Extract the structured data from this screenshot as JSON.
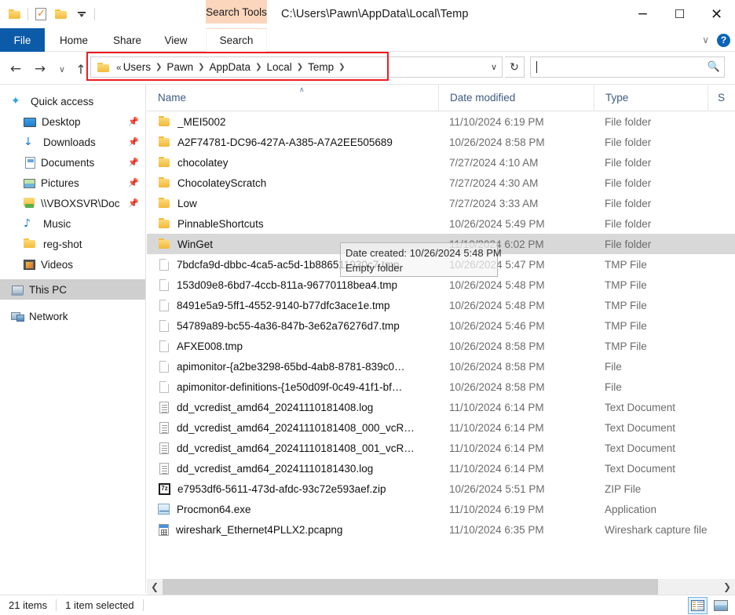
{
  "window": {
    "title": "C:\\Users\\Pawn\\AppData\\Local\\Temp",
    "contextual_tab": "Search Tools",
    "minimize": "−",
    "maximize": "☐",
    "close": "✕",
    "ribbon_expand": "∨",
    "help": "?"
  },
  "quick_access_toolbar": {
    "folder": "folder-icon",
    "properties": "properties-icon",
    "new_folder": "new-folder-icon",
    "customize": "customize-icon"
  },
  "ribbon": {
    "tabs": [
      {
        "label": "File"
      },
      {
        "label": "Home"
      },
      {
        "label": "Share"
      },
      {
        "label": "View"
      },
      {
        "label": "Search"
      }
    ]
  },
  "navigation": {
    "back": "←",
    "forward": "→",
    "recent": "∨",
    "up": "↑",
    "refresh": "↻",
    "dropdown": "∨",
    "overflow": "«",
    "separator": "❯",
    "breadcrumbs": [
      "Users",
      "Pawn",
      "AppData",
      "Local",
      "Temp"
    ],
    "highlight_color": "#ee1c22"
  },
  "search": {
    "value": "",
    "placeholder": "",
    "icon": "search-icon"
  },
  "sidebar": {
    "items": [
      {
        "label": "Quick access",
        "icon": "star-icon",
        "pinned": false,
        "selected": false,
        "indent": 0
      },
      {
        "label": "Desktop",
        "icon": "desktop-icon",
        "pinned": true,
        "selected": false,
        "indent": 1
      },
      {
        "label": "Downloads",
        "icon": "download-icon",
        "pinned": true,
        "selected": false,
        "indent": 1
      },
      {
        "label": "Documents",
        "icon": "documents-icon",
        "pinned": true,
        "selected": false,
        "indent": 1
      },
      {
        "label": "Pictures",
        "icon": "pictures-icon",
        "pinned": true,
        "selected": false,
        "indent": 1
      },
      {
        "label": "\\\\VBOXSVR\\Doc",
        "icon": "network-folder-icon",
        "pinned": true,
        "selected": false,
        "indent": 1
      },
      {
        "label": "Music",
        "icon": "music-icon",
        "pinned": false,
        "selected": false,
        "indent": 1
      },
      {
        "label": "reg-shot",
        "icon": "folder-icon",
        "pinned": false,
        "selected": false,
        "indent": 1
      },
      {
        "label": "Videos",
        "icon": "videos-icon",
        "pinned": false,
        "selected": false,
        "indent": 1
      },
      {
        "label": "This PC",
        "icon": "computer-icon",
        "pinned": false,
        "selected": true,
        "indent": 0
      },
      {
        "label": "Network",
        "icon": "network-icon",
        "pinned": false,
        "selected": false,
        "indent": 0
      }
    ]
  },
  "file_list": {
    "columns": [
      {
        "label": "Name",
        "sorted": true,
        "sort_caret": "∧"
      },
      {
        "label": "Date modified",
        "sorted": false
      },
      {
        "label": "Type",
        "sorted": false
      },
      {
        "label": "S",
        "sorted": false
      }
    ],
    "rows": [
      {
        "name": "_MEI5002",
        "date": "11/10/2024 6:19 PM",
        "type": "File folder",
        "icon": "folder-icon",
        "selected": false
      },
      {
        "name": "A2F74781-DC96-427A-A385-A7A2EE505689",
        "date": "10/26/2024 8:58 PM",
        "type": "File folder",
        "icon": "folder-icon",
        "selected": false
      },
      {
        "name": "chocolatey",
        "date": "7/27/2024 4:10 AM",
        "type": "File folder",
        "icon": "folder-icon",
        "selected": false
      },
      {
        "name": "ChocolateyScratch",
        "date": "7/27/2024 4:30 AM",
        "type": "File folder",
        "icon": "folder-icon",
        "selected": false
      },
      {
        "name": "Low",
        "date": "7/27/2024 3:33 AM",
        "type": "File folder",
        "icon": "folder-icon",
        "selected": false
      },
      {
        "name": "PinnableShortcuts",
        "date": "10/26/2024 5:49 PM",
        "type": "File folder",
        "icon": "folder-icon",
        "selected": false
      },
      {
        "name": "WinGet",
        "date": "11/10/2024 6:02 PM",
        "type": "File folder",
        "icon": "folder-icon",
        "selected": true
      },
      {
        "name": "7bdcfa9d-dbbc-4ca5-ac5d-1b886511930c7.tmp",
        "date": "10/26/2024 5:47 PM",
        "type": "TMP File",
        "icon": "blank-file-icon",
        "selected": false
      },
      {
        "name": "153d09e8-6bd7-4ccb-811a-96770118bea4.tmp",
        "date": "10/26/2024 5:48 PM",
        "type": "TMP File",
        "icon": "blank-file-icon",
        "selected": false
      },
      {
        "name": "8491e5a9-5ff1-4552-9140-b77dfc3ace1e.tmp",
        "date": "10/26/2024 5:48 PM",
        "type": "TMP File",
        "icon": "blank-file-icon",
        "selected": false
      },
      {
        "name": "54789a89-bc55-4a36-847b-3e62a76276d7.tmp",
        "date": "10/26/2024 5:46 PM",
        "type": "TMP File",
        "icon": "blank-file-icon",
        "selected": false
      },
      {
        "name": "AFXE008.tmp",
        "date": "10/26/2024 8:58 PM",
        "type": "TMP File",
        "icon": "blank-file-icon",
        "selected": false
      },
      {
        "name": "apimonitor-{a2be3298-65bd-4ab8-8781-839c0…",
        "date": "10/26/2024 8:58 PM",
        "type": "File",
        "icon": "blank-file-icon",
        "selected": false
      },
      {
        "name": "apimonitor-definitions-{1e50d09f-0c49-41f1-bf…",
        "date": "10/26/2024 8:58 PM",
        "type": "File",
        "icon": "blank-file-icon",
        "selected": false
      },
      {
        "name": "dd_vcredist_amd64_20241110181408.log",
        "date": "11/10/2024 6:14 PM",
        "type": "Text Document",
        "icon": "text-file-icon",
        "selected": false
      },
      {
        "name": "dd_vcredist_amd64_20241110181408_000_vcR…",
        "date": "11/10/2024 6:14 PM",
        "type": "Text Document",
        "icon": "text-file-icon",
        "selected": false
      },
      {
        "name": "dd_vcredist_amd64_20241110181408_001_vcR…",
        "date": "11/10/2024 6:14 PM",
        "type": "Text Document",
        "icon": "text-file-icon",
        "selected": false
      },
      {
        "name": "dd_vcredist_amd64_20241110181430.log",
        "date": "11/10/2024 6:14 PM",
        "type": "Text Document",
        "icon": "text-file-icon",
        "selected": false
      },
      {
        "name": "e7953df6-5611-473d-afdc-93c72e593aef.zip",
        "date": "10/26/2024 5:51 PM",
        "type": "ZIP File",
        "icon": "zip-file-icon",
        "selected": false
      },
      {
        "name": "Procmon64.exe",
        "date": "11/10/2024 6:19 PM",
        "type": "Application",
        "icon": "application-icon",
        "selected": false
      },
      {
        "name": "wireshark_Ethernet4PLLX2.pcapng",
        "date": "11/10/2024 6:35 PM",
        "type": "Wireshark capture file",
        "icon": "pcapng-file-icon",
        "selected": false
      }
    ]
  },
  "tooltip": {
    "line1": "Date created: 10/26/2024 5:48 PM",
    "line2": "Empty folder"
  },
  "scrollbar": {
    "left_arrow": "❮",
    "right_arrow": "❯"
  },
  "status_bar": {
    "item_count": "21 items",
    "selection": "1 item selected",
    "details_view": "details-view-icon",
    "large_icons_view": "large-icons-view-icon"
  },
  "zip_badge": "7z"
}
